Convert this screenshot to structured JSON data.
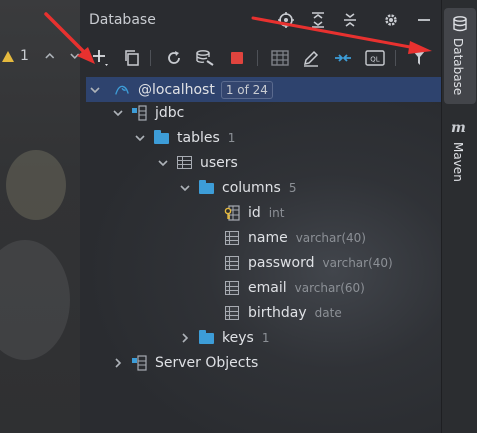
{
  "colors": {
    "panel_bg": "#2b2d30",
    "selection": "#2e436e",
    "folder": "#3d9dd8",
    "stop_red": "#e0443e",
    "arrow_red": "#e8312f",
    "hint_text": "#8c9096"
  },
  "left_toolbar": {
    "warning_count": "1",
    "up_chevron": "^",
    "down_chevron": "v"
  },
  "panel": {
    "title": "Database",
    "header_icons": [
      "locate-icon",
      "expand-all-icon",
      "collapse-all-icon",
      "gear-icon",
      "minimize-icon"
    ]
  },
  "toolbar": {
    "buttons": [
      "add-icon",
      "copy-icon",
      "refresh-icon",
      "schema-sync-icon",
      "stop-icon",
      "table-editor-icon",
      "edit-icon",
      "jump-to-icon",
      "query-console-icon",
      "filter-icon"
    ],
    "query_console_text": "QL"
  },
  "tree": {
    "datasource": {
      "name": "@localhost",
      "badge": "1 of 24"
    },
    "schema": {
      "name": "jdbc"
    },
    "tables_folder": {
      "name": "tables",
      "count": "1"
    },
    "table": {
      "name": "users"
    },
    "columns_folder": {
      "name": "columns",
      "count": "5"
    },
    "columns": [
      {
        "name": "id",
        "type": "int"
      },
      {
        "name": "name",
        "type": "varchar(40)"
      },
      {
        "name": "password",
        "type": "varchar(40)"
      },
      {
        "name": "email",
        "type": "varchar(60)"
      },
      {
        "name": "birthday",
        "type": "date"
      }
    ],
    "keys_folder": {
      "name": "keys",
      "count": "1"
    },
    "server_objects": {
      "name": "Server Objects"
    }
  },
  "right_strip": {
    "database_label": "Database",
    "maven_label": "Maven",
    "maven_glyph": "m"
  }
}
